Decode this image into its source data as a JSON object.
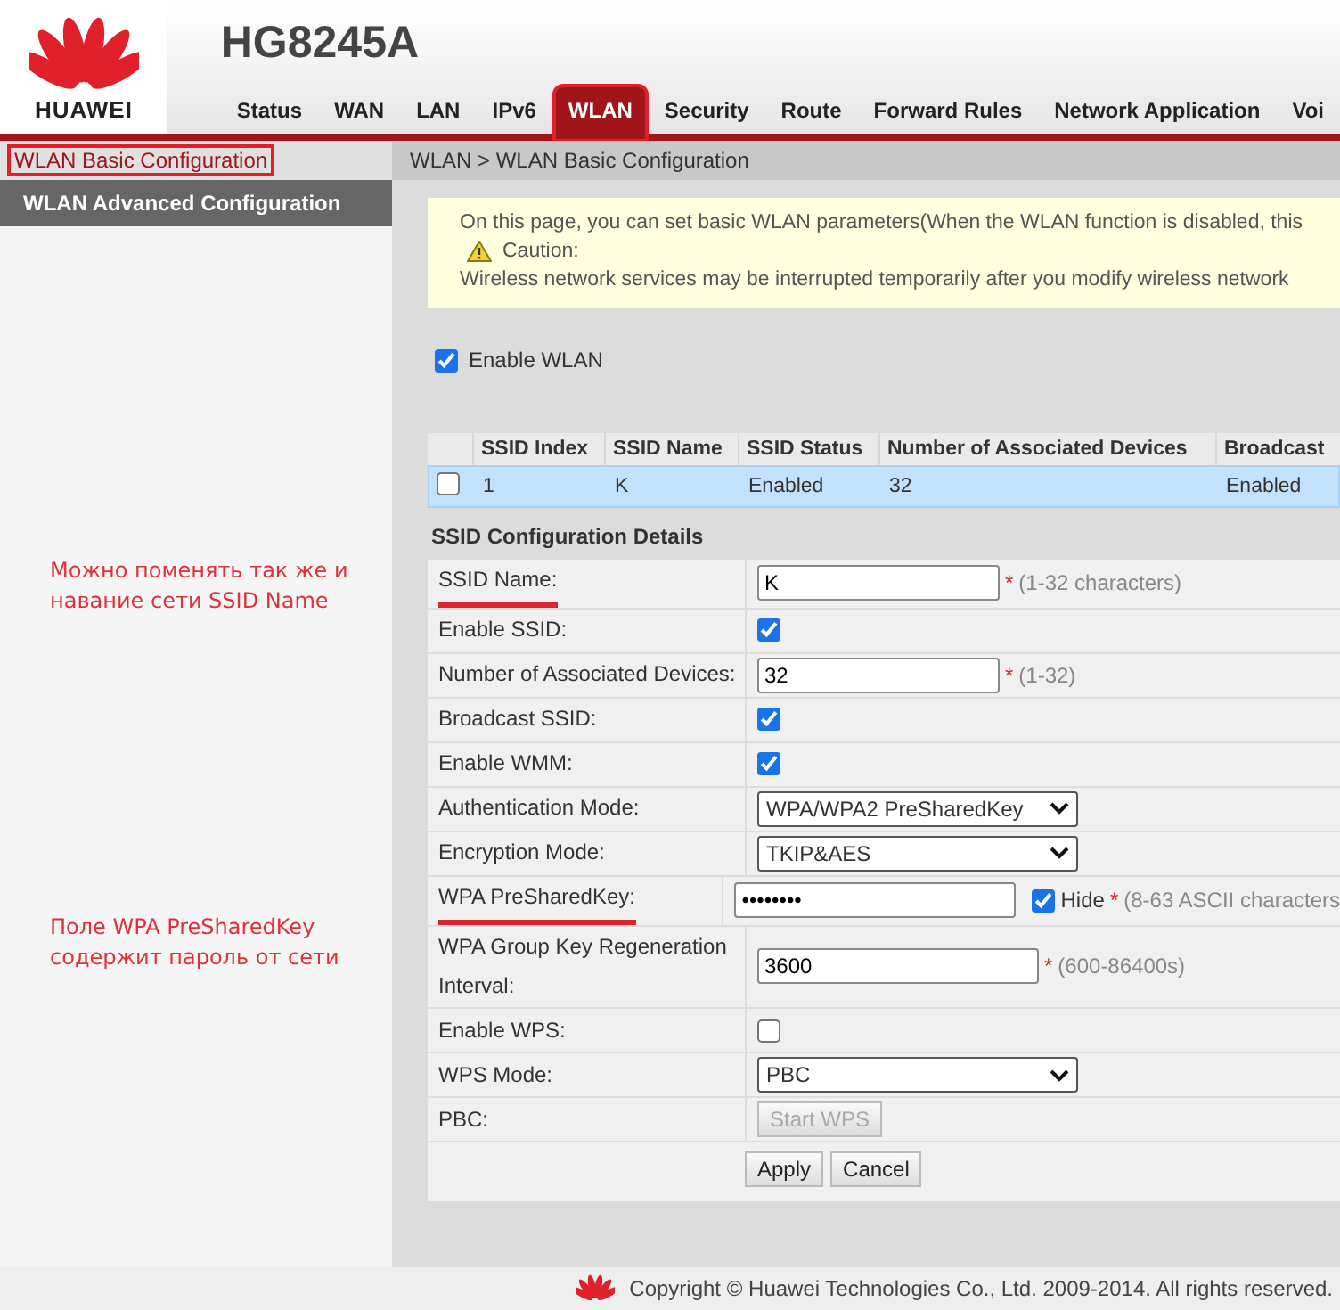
{
  "header": {
    "brand": "HUAWEI",
    "model": "HG8245A"
  },
  "nav_tabs": [
    {
      "label": "Status",
      "selected": false,
      "highlighted": false
    },
    {
      "label": "WAN",
      "selected": false,
      "highlighted": false
    },
    {
      "label": "LAN",
      "selected": false,
      "highlighted": false
    },
    {
      "label": "IPv6",
      "selected": false,
      "highlighted": false
    },
    {
      "label": "WLAN",
      "selected": true,
      "highlighted": true
    },
    {
      "label": "Security",
      "selected": false,
      "highlighted": false
    },
    {
      "label": "Route",
      "selected": false,
      "highlighted": false
    },
    {
      "label": "Forward Rules",
      "selected": false,
      "highlighted": false
    },
    {
      "label": "Network Application",
      "selected": false,
      "highlighted": false
    },
    {
      "label": "Voi",
      "selected": false,
      "highlighted": false
    }
  ],
  "sidebar": {
    "items": [
      {
        "label": "WLAN Basic Configuration",
        "selected": true,
        "highlighted": true
      },
      {
        "label": "WLAN Advanced Configuration",
        "selected": false,
        "highlighted": false
      }
    ],
    "notes": [
      "Можно поменять так же и навание сети SSID Name",
      "Поле WPA PreSharedKey содержит пароль от сети"
    ]
  },
  "breadcrumb": "WLAN > WLAN Basic Configuration",
  "notice": {
    "text": "On this page, you can set basic WLAN parameters(When the WLAN function is disabled, this",
    "caution": "Caution:",
    "warning": "Wireless network services may be interrupted temporarily after you modify wireless network"
  },
  "enable_wlan": {
    "label": "Enable WLAN",
    "checked": true
  },
  "ssid_table": {
    "columns": [
      "SSID Index",
      "SSID Name",
      "SSID Status",
      "Number of Associated Devices",
      "Broadcast"
    ],
    "rows": [
      {
        "highlighted": true,
        "checked": false,
        "cells": [
          "1",
          "K",
          "Enabled",
          "32",
          "Enabled"
        ]
      }
    ]
  },
  "details": {
    "title": "SSID Configuration Details",
    "fields": [
      {
        "kind": "text",
        "label": "SSID Name:",
        "value": "K",
        "mark": "*",
        "hint": "(1-32 characters)",
        "underlined": true
      },
      {
        "kind": "checkbox",
        "label": "Enable SSID:",
        "checked": true,
        "underlined": false
      },
      {
        "kind": "text",
        "label": "Number of Associated Devices:",
        "value": "32",
        "mark": "*",
        "hint": "(1-32)",
        "underlined": false
      },
      {
        "kind": "checkbox",
        "label": "Broadcast SSID:",
        "checked": true,
        "underlined": false
      },
      {
        "kind": "checkbox",
        "label": "Enable WMM:",
        "checked": true,
        "underlined": false
      },
      {
        "kind": "select",
        "label": "Authentication Mode:",
        "value": "WPA/WPA2 PreSharedKey",
        "underlined": false
      },
      {
        "kind": "select",
        "label": "Encryption Mode:",
        "value": "TKIP&AES",
        "underlined": false
      },
      {
        "kind": "password",
        "label": "WPA PreSharedKey:",
        "value": "••••••••",
        "hide_label": "Hide",
        "hide_checked": true,
        "mark": "*",
        "hint": "(8-63 ASCII characters",
        "underlined": true
      },
      {
        "kind": "wide",
        "label": "WPA Group Key Regeneration Interval:",
        "value": "3600",
        "mark": "*",
        "hint": "(600-86400s)",
        "underlined": false
      },
      {
        "kind": "checkbox",
        "label": "Enable WPS:",
        "checked": false,
        "underlined": false
      },
      {
        "kind": "select",
        "label": "WPS Mode:",
        "value": "PBC",
        "underlined": false
      },
      {
        "kind": "button",
        "label": "PBC:",
        "value": "Start WPS",
        "disabled": true,
        "underlined": false
      }
    ]
  },
  "buttons": [
    "Apply",
    "Cancel"
  ],
  "footer": "Copyright © Huawei Technologies Co., Ltd. 2009-2014. All rights reserved."
}
